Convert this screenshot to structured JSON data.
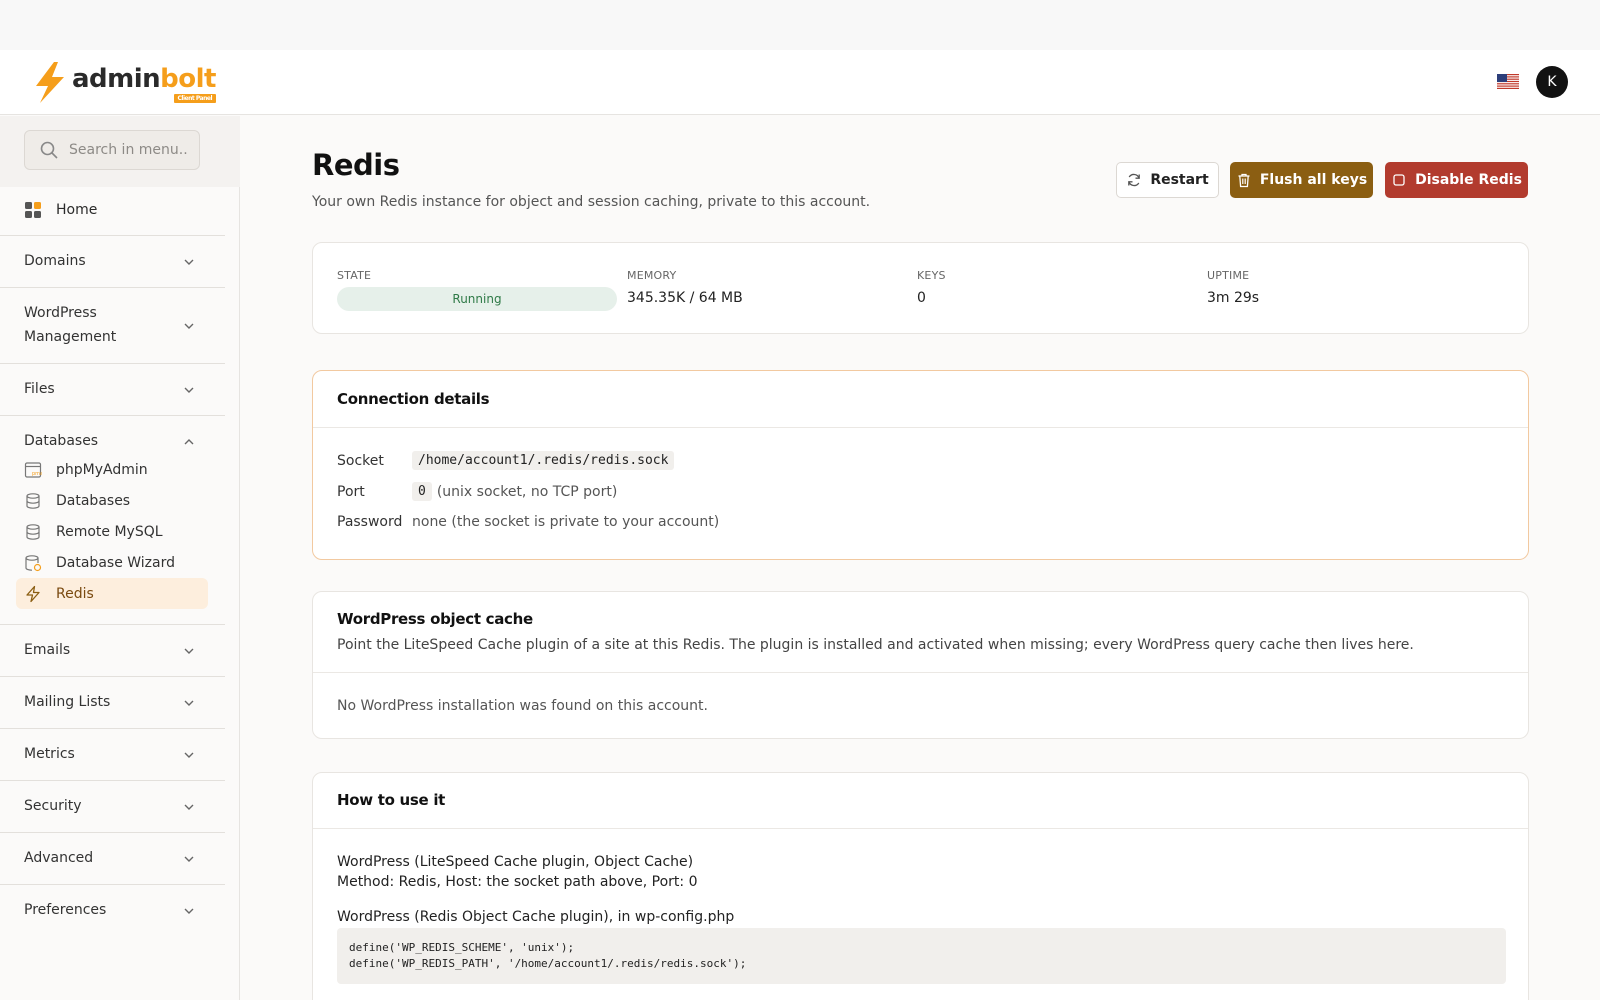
{
  "brand": {
    "name_part1": "admin",
    "name_part2": "bolt",
    "badge": "Client Panel",
    "accent": "#f59e1b"
  },
  "header": {
    "avatar_initial": "K",
    "flag_icon": "us-flag-icon"
  },
  "sidebar": {
    "search_placeholder": "Search in menu..",
    "home_label": "Home",
    "sections": [
      {
        "label": "Domains"
      },
      {
        "label": "WordPress Management"
      },
      {
        "label": "Files"
      },
      {
        "label": "Databases"
      },
      {
        "label": "Emails"
      },
      {
        "label": "Mailing Lists"
      },
      {
        "label": "Metrics"
      },
      {
        "label": "Security"
      },
      {
        "label": "Advanced"
      },
      {
        "label": "Preferences"
      }
    ],
    "wp_line1": "WordPress",
    "wp_line2": "Management",
    "databases_items": [
      {
        "label": "phpMyAdmin",
        "icon": "phpmyadmin-icon"
      },
      {
        "label": "Databases",
        "icon": "database-icon"
      },
      {
        "label": "Remote MySQL",
        "icon": "database-icon"
      },
      {
        "label": "Database Wizard",
        "icon": "database-wizard-icon"
      },
      {
        "label": "Redis",
        "icon": "bolt-icon",
        "active": true
      }
    ]
  },
  "page": {
    "title": "Redis",
    "subtitle": "Your own Redis instance for object and session caching, private to this account.",
    "buttons": {
      "restart": "Restart",
      "flush": "Flush all keys",
      "disable": "Disable Redis"
    }
  },
  "stats": {
    "state_label": "STATE",
    "state_value": "Running",
    "memory_label": "MEMORY",
    "memory_value": "345.35K / 64 MB",
    "keys_label": "KEYS",
    "keys_value": "0",
    "uptime_label": "UPTIME",
    "uptime_value": "3m 29s"
  },
  "connection": {
    "title": "Connection details",
    "socket_label": "Socket",
    "socket_value": "/home/account1/.redis/redis.sock",
    "port_label": "Port",
    "port_value": "0",
    "port_note": "(unix socket, no TCP port)",
    "password_label": "Password",
    "password_value": "none (the socket is private to your account)"
  },
  "wp_cache": {
    "title": "WordPress object cache",
    "description": "Point the LiteSpeed Cache plugin of a site at this Redis. The plugin is installed and activated when missing; every WordPress query cache then lives here.",
    "empty_message": "No WordPress installation was found on this account."
  },
  "howto": {
    "title": "How to use it",
    "ls_title": "WordPress (LiteSpeed Cache plugin, Object Cache)",
    "ls_detail": "Method: Redis, Host: the socket path above, Port: 0",
    "roc_title": "WordPress (Redis Object Cache plugin), in wp-config.php",
    "code": "define('WP_REDIS_SCHEME', 'unix');\ndefine('WP_REDIS_PATH', '/home/account1/.redis/redis.sock');"
  }
}
